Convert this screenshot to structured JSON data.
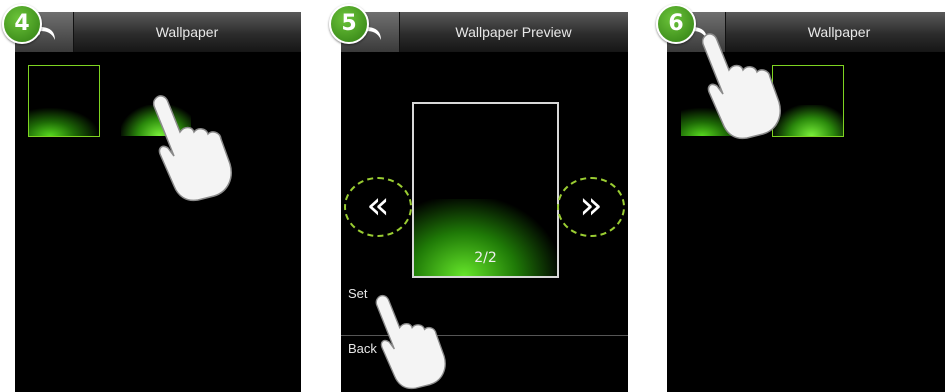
{
  "screens": [
    {
      "step": "4",
      "title": "Wallpaper"
    },
    {
      "step": "5",
      "title": "Wallpaper Preview",
      "page_indicator": "2/2",
      "prev_label": "«",
      "next_label": "»",
      "set_label": "Set",
      "back_label": "Back"
    },
    {
      "step": "6",
      "title": "Wallpaper"
    }
  ],
  "colors": {
    "accent": "#7ed321",
    "badge": "#3e9a1b",
    "background": "#000000"
  },
  "icons": {
    "back": "return-arrow-icon",
    "hand": "pointing-hand-icon"
  }
}
